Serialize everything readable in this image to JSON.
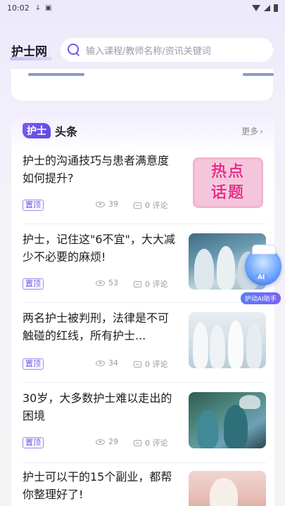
{
  "status_bar": {
    "time": "10:02"
  },
  "header": {
    "brand": "护士网",
    "search_placeholder": "输入课程/教师名称/资讯关键词"
  },
  "news": {
    "badge": "护士",
    "title": "头条",
    "more": "更多",
    "items": [
      {
        "title": "护士的沟通技巧与患者满意度如何提升?",
        "tag": "置顶",
        "views": "39",
        "comments": "0 评论",
        "thumb_text": [
          "热点",
          "话题"
        ]
      },
      {
        "title": "护士，记住这\"6不宜\"，大大减少不必要的麻烦!",
        "tag": "置顶",
        "views": "53",
        "comments": "0 评论"
      },
      {
        "title": "两名护士被判刑，法律是不可触碰的红线，所有护士...",
        "tag": "置顶",
        "views": "34",
        "comments": "0 评论"
      },
      {
        "title": "30岁，大多数护士难以走出的困境",
        "tag": "置顶",
        "views": "29",
        "comments": "0 评论"
      },
      {
        "title": "护士可以干的15个副业，都帮你整理好了!"
      }
    ]
  },
  "ai_assistant": {
    "face_text": "AI",
    "label": "护动AI助手"
  }
}
